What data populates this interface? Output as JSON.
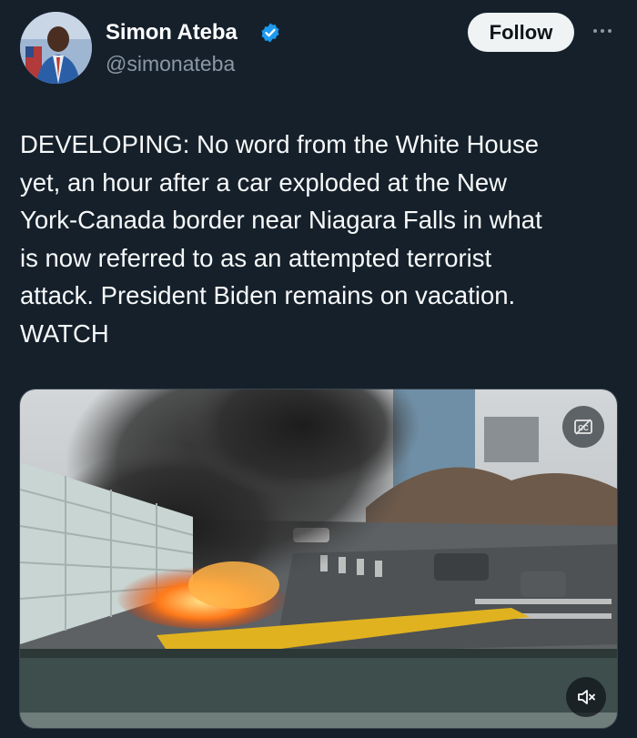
{
  "author": {
    "display_name": "Simon Ateba",
    "handle": "@simonateba",
    "verified": true,
    "verified_color": "#1d9bf0"
  },
  "actions": {
    "follow_label": "Follow",
    "more_icon": "more-horizontal-icon"
  },
  "tweet": {
    "text": "DEVELOPING: No word from the White House\nyet, an hour after a car exploded at the New\nYork-Canada border near Niagara Falls in what\nis now referred to as an attempted terrorist\nattack. President Biden remains on vacation.\nWATCH"
  },
  "media": {
    "type": "video",
    "description_icons": [
      "captions-icon",
      "mute-icon"
    ]
  },
  "colors": {
    "background": "#15202b",
    "text": "#f7f9f9",
    "secondary_text": "#8b98a5",
    "follow_bg": "#eff3f4"
  }
}
